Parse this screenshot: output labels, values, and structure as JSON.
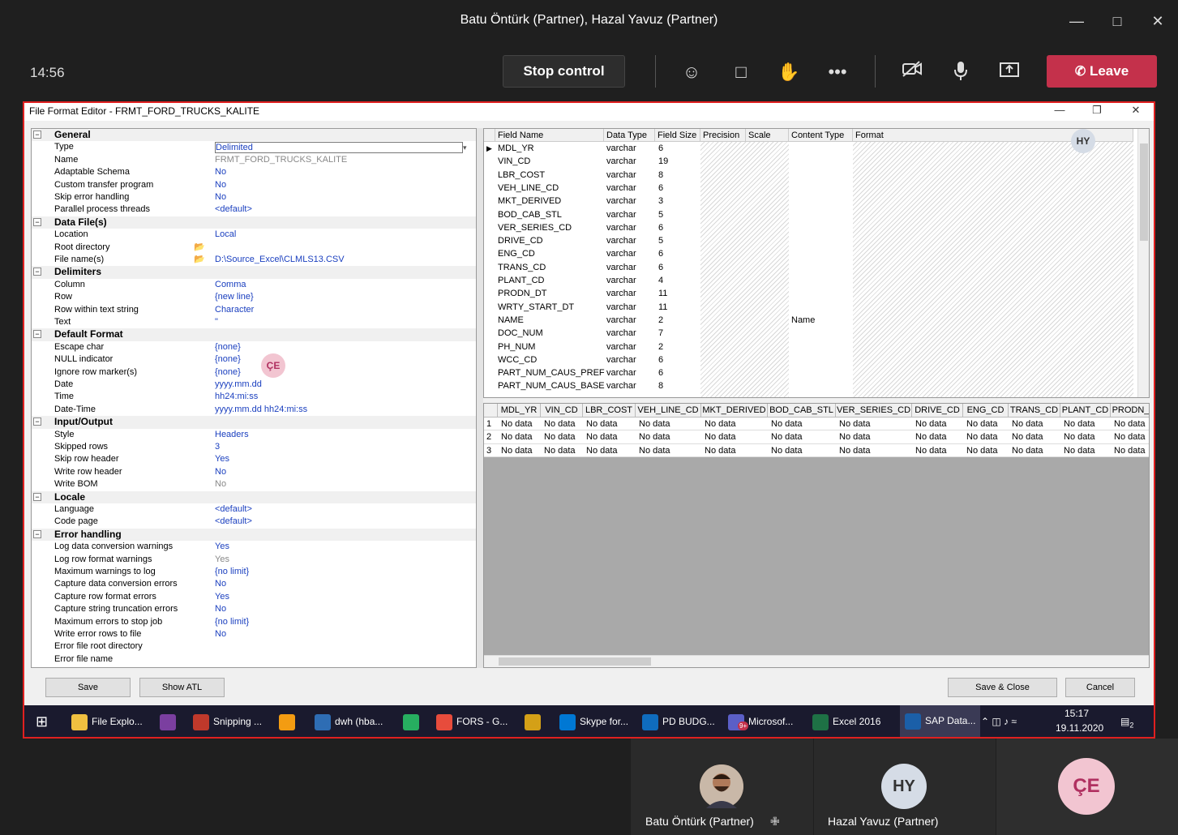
{
  "window": {
    "title": "Batu Öntürk (Partner), Hazal Yavuz (Partner)"
  },
  "callbar": {
    "time": "14:56",
    "stop_control": "Stop control",
    "leave": "Leave"
  },
  "editor": {
    "title": "File Format Editor - FRMT_FORD_TRUCKS_KALITE",
    "presence_hy": "HY",
    "presence_ce": "ÇE",
    "properties": [
      {
        "cat": "General"
      },
      {
        "label": "Type",
        "value": "Delimited"
      },
      {
        "label": "Name",
        "value": "FRMT_FORD_TRUCKS_KALITE",
        "gray": true
      },
      {
        "label": "Adaptable Schema",
        "value": "No"
      },
      {
        "label": "Custom transfer program",
        "value": "No"
      },
      {
        "label": "Skip error handling",
        "value": "No"
      },
      {
        "label": "Parallel process threads",
        "value": "<default>"
      },
      {
        "cat": "Data File(s)"
      },
      {
        "label": "Location",
        "value": "Local"
      },
      {
        "label": "Root directory",
        "value": "",
        "folder": true
      },
      {
        "label": "File name(s)",
        "value": "D:\\Source_Excel\\CLMLS13.CSV",
        "folder": true
      },
      {
        "cat": "Delimiters"
      },
      {
        "label": "Column",
        "value": "Comma"
      },
      {
        "label": "Row",
        "value": "{new line}"
      },
      {
        "label": "Row within text string",
        "value": "Character"
      },
      {
        "label": "Text",
        "value": "\""
      },
      {
        "cat": "Default Format"
      },
      {
        "label": "Escape char",
        "value": "{none}"
      },
      {
        "label": "NULL indicator",
        "value": "{none}"
      },
      {
        "label": "Ignore row marker(s)",
        "value": "{none}"
      },
      {
        "label": "Date",
        "value": "yyyy.mm.dd"
      },
      {
        "label": "Time",
        "value": "hh24:mi:ss"
      },
      {
        "label": "Date-Time",
        "value": "yyyy.mm.dd hh24:mi:ss"
      },
      {
        "cat": "Input/Output"
      },
      {
        "label": "Style",
        "value": "Headers"
      },
      {
        "label": "Skipped rows",
        "value": "3"
      },
      {
        "label": "Skip row header",
        "value": "Yes"
      },
      {
        "label": "Write row header",
        "value": "No"
      },
      {
        "label": "Write BOM",
        "value": "No",
        "gray": true
      },
      {
        "cat": "Locale"
      },
      {
        "label": "Language",
        "value": "<default>"
      },
      {
        "label": "Code page",
        "value": "<default>"
      },
      {
        "cat": "Error handling"
      },
      {
        "label": "Log data conversion warnings",
        "value": "Yes"
      },
      {
        "label": "Log row format warnings",
        "value": "Yes",
        "gray": true
      },
      {
        "label": "Maximum warnings to log",
        "value": "{no limit}"
      },
      {
        "label": "Capture data conversion errors",
        "value": "No"
      },
      {
        "label": "Capture row format errors",
        "value": "Yes"
      },
      {
        "label": "Capture string truncation errors",
        "value": "No"
      },
      {
        "label": "Maximum errors to stop job",
        "value": "{no limit}"
      },
      {
        "label": "Write error rows to file",
        "value": "No"
      },
      {
        "label": "Error file root directory",
        "value": ""
      },
      {
        "label": "Error file name",
        "value": ""
      }
    ],
    "field_columns": [
      "Field Name",
      "Data Type",
      "Field Size",
      "Precision",
      "Scale",
      "Content Type",
      "Format"
    ],
    "fields": [
      [
        "MDL_YR",
        "varchar",
        "6",
        ""
      ],
      [
        "VIN_CD",
        "varchar",
        "19",
        ""
      ],
      [
        "LBR_COST",
        "varchar",
        "8",
        ""
      ],
      [
        "VEH_LINE_CD",
        "varchar",
        "6",
        ""
      ],
      [
        "MKT_DERIVED",
        "varchar",
        "3",
        ""
      ],
      [
        "BOD_CAB_STL",
        "varchar",
        "5",
        ""
      ],
      [
        "VER_SERIES_CD",
        "varchar",
        "6",
        ""
      ],
      [
        "DRIVE_CD",
        "varchar",
        "5",
        ""
      ],
      [
        "ENG_CD",
        "varchar",
        "6",
        ""
      ],
      [
        "TRANS_CD",
        "varchar",
        "6",
        ""
      ],
      [
        "PLANT_CD",
        "varchar",
        "4",
        ""
      ],
      [
        "PRODN_DT",
        "varchar",
        "11",
        ""
      ],
      [
        "WRTY_START_DT",
        "varchar",
        "11",
        ""
      ],
      [
        "NAME",
        "varchar",
        "2",
        "Name"
      ],
      [
        "DOC_NUM",
        "varchar",
        "7",
        ""
      ],
      [
        "PH_NUM",
        "varchar",
        "2",
        ""
      ],
      [
        "WCC_CD",
        "varchar",
        "6",
        ""
      ],
      [
        "PART_NUM_CAUS_PREF",
        "varchar",
        "6",
        ""
      ],
      [
        "PART_NUM_CAUS_BASE",
        "varchar",
        "8",
        ""
      ]
    ],
    "data_columns": [
      "MDL_YR",
      "VIN_CD",
      "LBR_COST",
      "VEH_LINE_CD",
      "MKT_DERIVED",
      "BOD_CAB_STL",
      "VER_SERIES_CD",
      "DRIVE_CD",
      "ENG_CD",
      "TRANS_CD",
      "PLANT_CD",
      "PRODN_"
    ],
    "data_rows": [
      "1",
      "2",
      "3"
    ],
    "no_data": "No data",
    "buttons": {
      "save": "Save",
      "show_atl": "Show ATL",
      "save_close": "Save & Close",
      "cancel": "Cancel"
    }
  },
  "taskbar": {
    "items": [
      {
        "label": "File Explo...",
        "icon": "folder-icon",
        "color": "#f0c040"
      },
      {
        "label": "",
        "icon": "onenote-icon",
        "color": "#7b3fa0"
      },
      {
        "label": "Snipping ...",
        "icon": "snipping-icon",
        "color": "#c0392b"
      },
      {
        "label": "",
        "icon": "app-icon",
        "color": "#f39c12"
      },
      {
        "label": "dwh (hba...",
        "icon": "dwh-icon",
        "color": "#2e6db4"
      },
      {
        "label": "",
        "icon": "project-icon",
        "color": "#27ae60"
      },
      {
        "label": "FORS - G...",
        "icon": "chrome-icon",
        "color": "#e74c3c"
      },
      {
        "label": "",
        "icon": "tool-icon",
        "color": "#d4a017"
      },
      {
        "label": "Skype for...",
        "icon": "skype-icon",
        "color": "#0078d4"
      },
      {
        "label": "PD BUDG...",
        "icon": "outlook-icon",
        "color": "#0f6cbd"
      },
      {
        "label": "Microsof...",
        "icon": "teams-icon",
        "color": "#5b5fc7"
      },
      {
        "label": "Excel 2016",
        "icon": "excel-icon",
        "color": "#1e7145"
      },
      {
        "label": "SAP Data...",
        "icon": "sap-icon",
        "color": "#1b5fa8"
      }
    ],
    "time": "15:17",
    "date": "19.11.2020",
    "notif_count": "2",
    "teams_badge": "9+"
  },
  "participants": [
    {
      "name": "Batu Öntürk (Partner)",
      "initials": ""
    },
    {
      "name": "Hazal Yavuz (Partner)",
      "initials": "HY"
    },
    {
      "name": "",
      "initials": "ÇE"
    }
  ]
}
